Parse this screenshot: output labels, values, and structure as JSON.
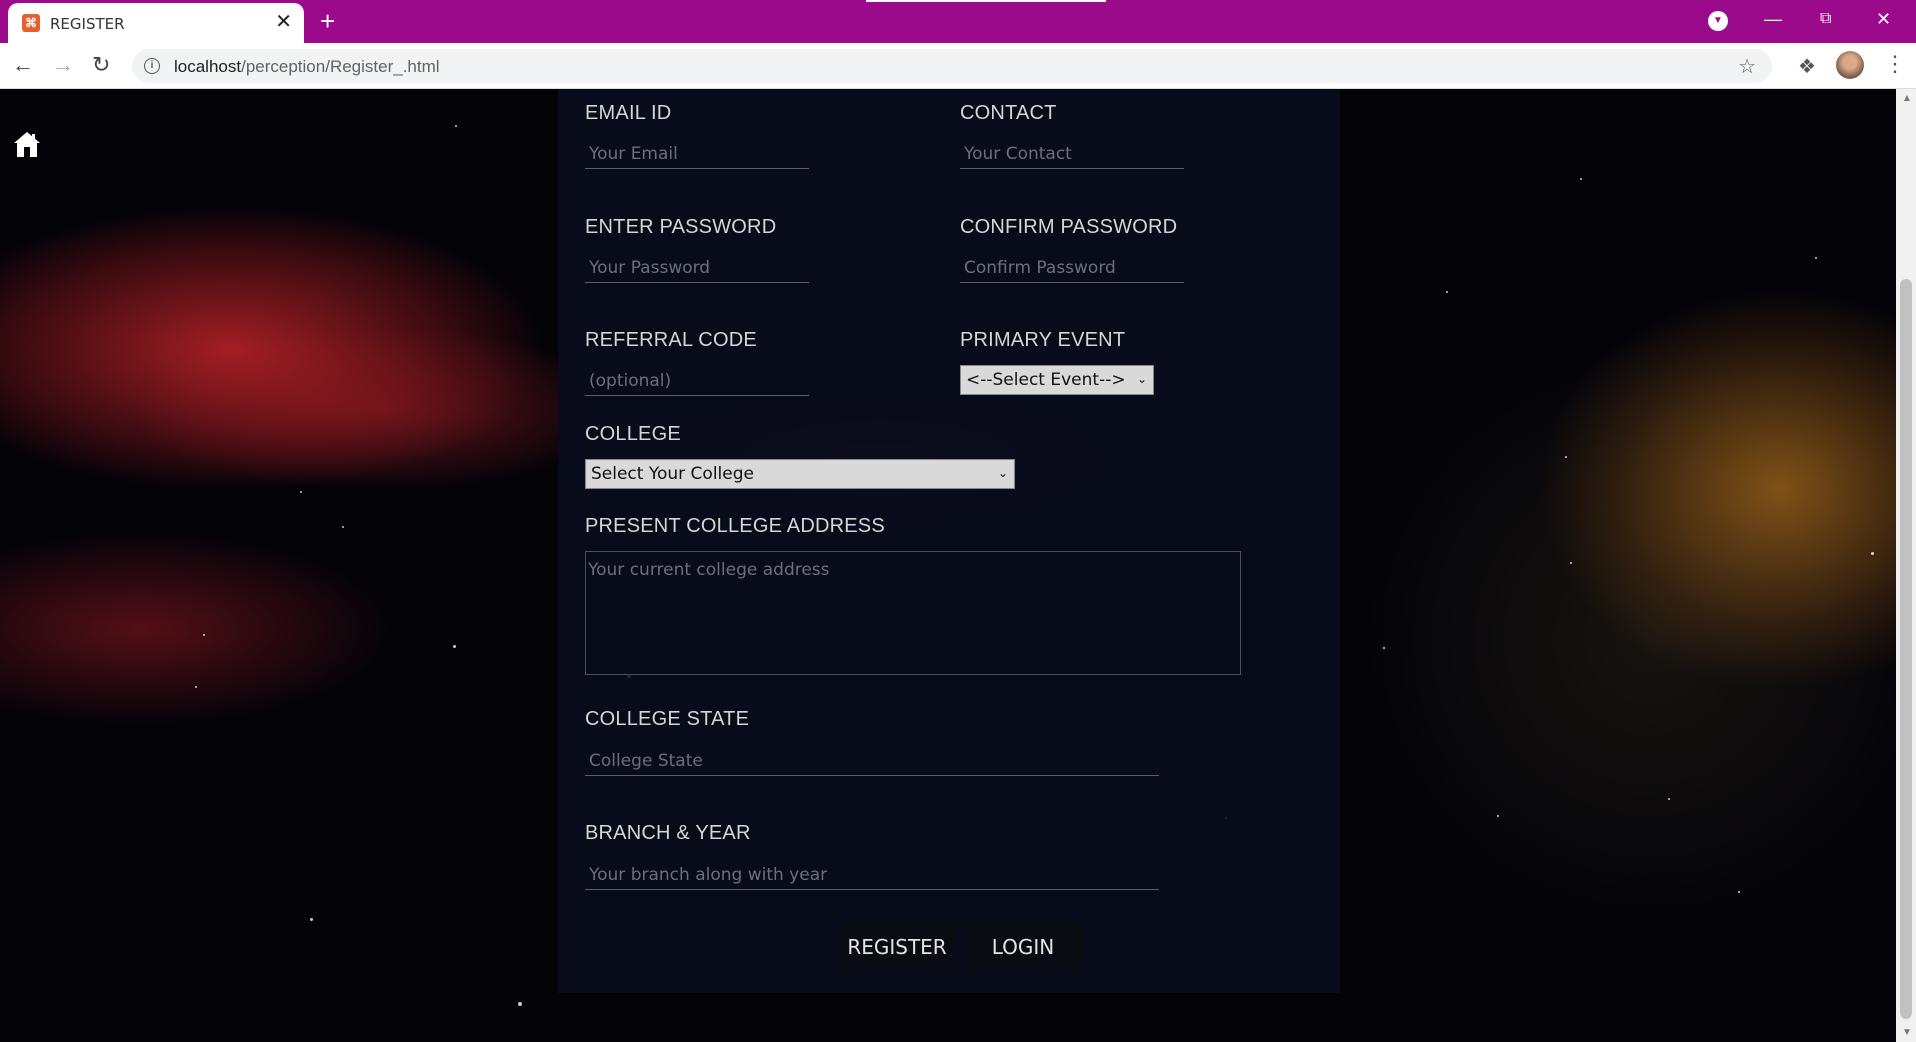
{
  "browser": {
    "tab_title": "REGISTER",
    "url_host": "localhost",
    "url_path": "/perception/Register_.html"
  },
  "form": {
    "email": {
      "label": "EMAIL ID",
      "placeholder": "Your Email"
    },
    "contact": {
      "label": "CONTACT",
      "placeholder": "Your Contact"
    },
    "password": {
      "label": "ENTER PASSWORD",
      "placeholder": "Your Password"
    },
    "confirm_password": {
      "label": "CONFIRM PASSWORD",
      "placeholder": "Confirm Password"
    },
    "referral": {
      "label": "REFERRAL CODE",
      "placeholder": "(optional)"
    },
    "primary_event": {
      "label": "PRIMARY EVENT",
      "selected": "<--Select Event-->"
    },
    "college": {
      "label": "COLLEGE",
      "selected": "Select Your College"
    },
    "college_address": {
      "label": "PRESENT COLLEGE ADDRESS",
      "placeholder": "Your current college address"
    },
    "college_state": {
      "label": "COLLEGE STATE",
      "placeholder": "College State"
    },
    "branch_year": {
      "label": "BRANCH & YEAR",
      "placeholder": "Your branch along with year"
    },
    "register_button": "REGISTER",
    "login_button": "LOGIN"
  },
  "colors": {
    "titlebar": "#9a0a8a",
    "panel": "#080c1c",
    "label": "#d6d6d6"
  },
  "icons": [
    "home-icon",
    "info-icon",
    "star-icon",
    "extensions-icon",
    "back-icon",
    "forward-icon",
    "reload-icon"
  ]
}
